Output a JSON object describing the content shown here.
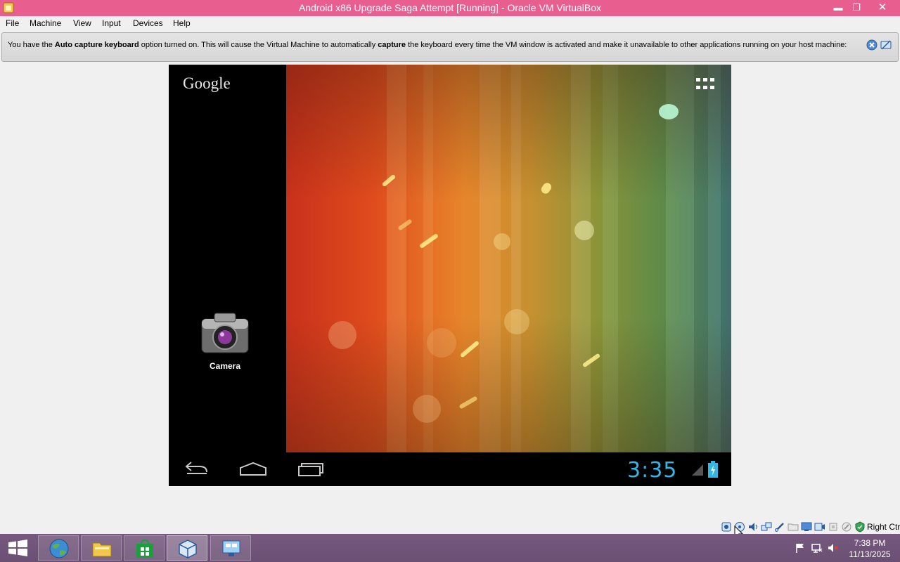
{
  "window": {
    "title": "Android x86 Upgrade Saga Attempt [Running] - Oracle VM VirtualBox",
    "colors": {
      "titlebar": "#e85f8f",
      "taskbar": "#6f5478"
    }
  },
  "menu": {
    "items": [
      "File",
      "Machine",
      "View",
      "Input",
      "Devices",
      "Help"
    ]
  },
  "infobar": {
    "part1": "You have the ",
    "bold1": "Auto capture keyboard",
    "part2": " option turned on. This will cause the Virtual Machine to automatically ",
    "bold2": "capture",
    "part3": " the keyboard every time the VM window is activated and make it unavailable to other applications running on your host machine:"
  },
  "android": {
    "google_label": "Google",
    "camera_label": "Camera",
    "clock": "3:35",
    "clock_color": "#33b5e5"
  },
  "status": {
    "host_key": "Right Ctrl"
  },
  "taskbar": {
    "time": "7:38 PM",
    "date": "11/13/2025"
  }
}
